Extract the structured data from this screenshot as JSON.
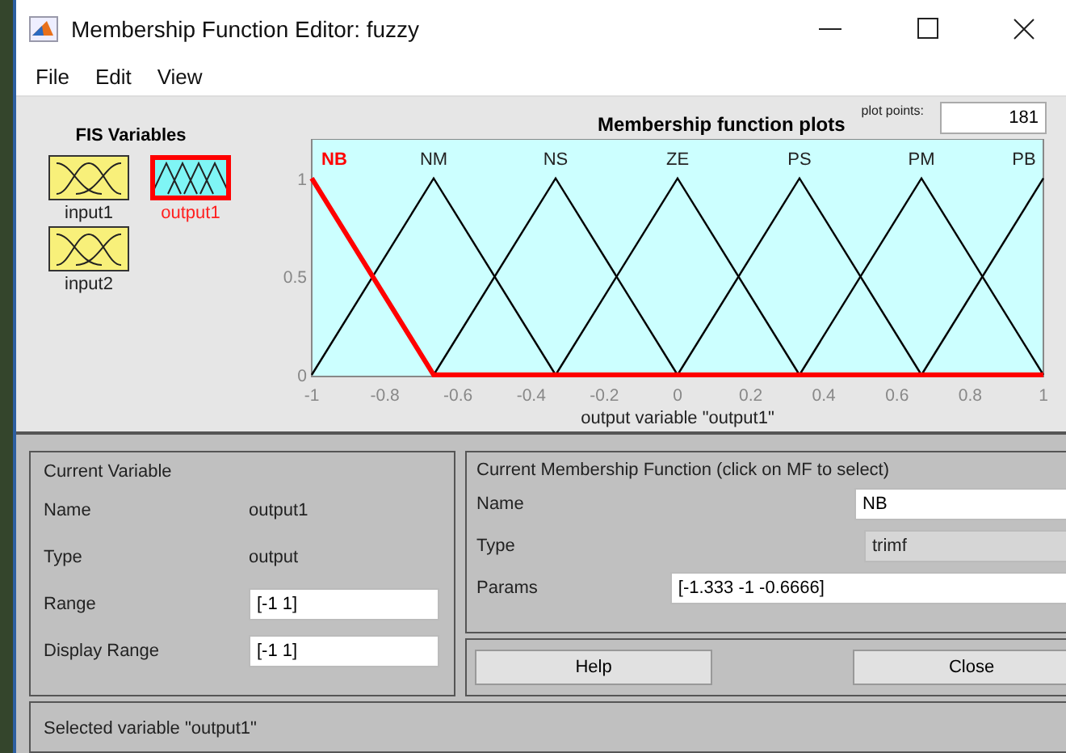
{
  "window": {
    "title": "Membership Function Editor: fuzzy"
  },
  "menu": [
    "File",
    "Edit",
    "View"
  ],
  "fis_variables": {
    "title": "FIS Variables",
    "items": [
      {
        "label": "input1",
        "kind": "input",
        "selected": false
      },
      {
        "label": "output1",
        "kind": "output",
        "selected": true
      },
      {
        "label": "input2",
        "kind": "input",
        "selected": false
      }
    ]
  },
  "plot": {
    "plot_points_label": "plot points:",
    "plot_points": "181",
    "chart_data": {
      "type": "line",
      "title": "Membership function plots",
      "xlabel": "output variable \"output1\"",
      "x": [
        -1,
        -0.6667,
        -0.3333,
        0,
        0.3333,
        0.6667,
        1
      ],
      "series": [
        {
          "name": "NB",
          "color": "#ff0000",
          "values": [
            1,
            0,
            0,
            0,
            0,
            0,
            0
          ]
        },
        {
          "name": "NM",
          "color": "#000000",
          "values": [
            0,
            1,
            0,
            null,
            null,
            null,
            null
          ]
        },
        {
          "name": "NS",
          "color": "#000000",
          "values": [
            null,
            0,
            1,
            0,
            null,
            null,
            null
          ]
        },
        {
          "name": "ZE",
          "color": "#000000",
          "values": [
            null,
            null,
            0,
            1,
            0,
            null,
            null
          ]
        },
        {
          "name": "PS",
          "color": "#000000",
          "values": [
            null,
            null,
            null,
            0,
            1,
            0,
            null
          ]
        },
        {
          "name": "PM",
          "color": "#000000",
          "values": [
            null,
            null,
            null,
            null,
            0,
            1,
            0
          ]
        },
        {
          "name": "PB",
          "color": "#000000",
          "values": [
            null,
            null,
            null,
            null,
            null,
            0,
            1
          ]
        }
      ],
      "xlim": [
        -1,
        1
      ],
      "ylim": [
        0,
        1.2
      ],
      "xticks": [
        -1,
        -0.8,
        -0.6,
        -0.4,
        -0.2,
        0,
        0.2,
        0.4,
        0.6,
        0.8,
        1
      ],
      "yticks": [
        0,
        0.5,
        1
      ]
    }
  },
  "current_variable": {
    "title": "Current Variable",
    "fields": [
      {
        "label": "Name",
        "value": "output1",
        "kind": "text"
      },
      {
        "label": "Type",
        "value": "output",
        "kind": "text"
      },
      {
        "label": "Range",
        "value": "[-1 1]",
        "kind": "input"
      },
      {
        "label": "Display Range",
        "value": "[-1 1]",
        "kind": "input"
      }
    ]
  },
  "current_mf": {
    "title": "Current Membership Function (click on MF to select)",
    "name_label": "Name",
    "name": "NB",
    "type_label": "Type",
    "type": "trimf",
    "params_label": "Params",
    "params": "[-1.333 -1 -0.6666]"
  },
  "buttons": [
    "Help",
    "Close"
  ],
  "status": "Selected variable \"output1\""
}
